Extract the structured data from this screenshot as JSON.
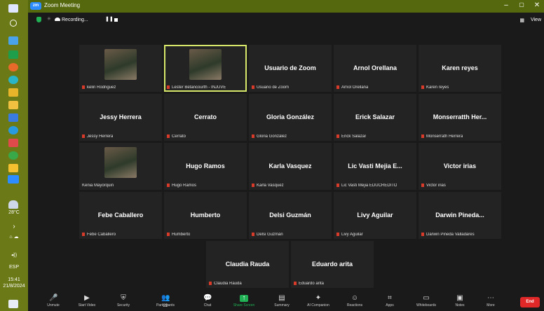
{
  "window": {
    "title": "Zoom Meeting",
    "zoom_badge": "zm"
  },
  "top": {
    "recording_label": "Recording...",
    "view_label": "View"
  },
  "participants": [
    {
      "display_name": "",
      "label": "kelin Rodriguez",
      "muted": true,
      "has_photo": true,
      "active": false
    },
    {
      "display_name": "",
      "label": "Lester Betancourth - INJUVE",
      "muted": true,
      "has_photo": true,
      "active": true
    },
    {
      "display_name": "Usuario de Zoom",
      "label": "Usuario de Zoom",
      "muted": true,
      "has_photo": false,
      "active": false
    },
    {
      "display_name": "Arnol Orellana",
      "label": "Arnol Orellana",
      "muted": true,
      "has_photo": false,
      "active": false
    },
    {
      "display_name": "Karen reyes",
      "label": "Karen reyes",
      "muted": true,
      "has_photo": false,
      "active": false
    },
    {
      "display_name": "Jessy Herrera",
      "label": "Jessy Herrera",
      "muted": true,
      "has_photo": false,
      "active": false
    },
    {
      "display_name": "Cerrato",
      "label": "Cerrato",
      "muted": true,
      "has_photo": false,
      "active": false
    },
    {
      "display_name": "Gloria González",
      "label": "Gloria González",
      "muted": true,
      "has_photo": false,
      "active": false
    },
    {
      "display_name": "Erick Salazar",
      "label": "Erick Salazar",
      "muted": true,
      "has_photo": false,
      "active": false
    },
    {
      "display_name": "Monserratth Her...",
      "label": "Monserrath Herrera",
      "muted": true,
      "has_photo": false,
      "active": false
    },
    {
      "display_name": "",
      "label": "Kenia Mayorquin",
      "muted": false,
      "has_photo": true,
      "active": false
    },
    {
      "display_name": "Hugo Ramos",
      "label": "Hugo Ramos",
      "muted": true,
      "has_photo": false,
      "active": false
    },
    {
      "display_name": "Karla Vasquez",
      "label": "Karla Vasquez",
      "muted": true,
      "has_photo": false,
      "active": false
    },
    {
      "display_name": "Lic Vasti Mejia E...",
      "label": "Lic Vasti Mejia EDUCREDITO",
      "muted": true,
      "has_photo": false,
      "active": false
    },
    {
      "display_name": "Victor irias",
      "label": "Victor irias",
      "muted": true,
      "has_photo": false,
      "active": false
    },
    {
      "display_name": "Febe Caballero",
      "label": "Febe Caballero",
      "muted": true,
      "has_photo": false,
      "active": false
    },
    {
      "display_name": "Humberto",
      "label": "Humberto",
      "muted": true,
      "has_photo": false,
      "active": false
    },
    {
      "display_name": "Delsi Guzmán",
      "label": "Delsi Guzmán",
      "muted": true,
      "has_photo": false,
      "active": false
    },
    {
      "display_name": "Livy Aguilar",
      "label": "Livy Aguilar",
      "muted": true,
      "has_photo": false,
      "active": false
    },
    {
      "display_name": "Darwin Pineda...",
      "label": "Darwin Pineda Valladares",
      "muted": true,
      "has_photo": false,
      "active": false
    },
    {
      "display_name": "Claudia Rauda",
      "label": "Claudia Rauda",
      "muted": true,
      "has_photo": false,
      "active": false
    },
    {
      "display_name": "Eduardo arita",
      "label": "Eduardo arita",
      "muted": true,
      "has_photo": false,
      "active": false
    }
  ],
  "taskbar": {
    "temperature": "28°C",
    "language": "ESP",
    "time": "15:41",
    "date": "21/8/2024"
  },
  "toolbar": {
    "unmute": "Unmute",
    "start_video": "Start Video",
    "security": "Security",
    "participants": "Participants",
    "participants_count": "22",
    "chat": "Chat",
    "share_screen": "Share Screen",
    "summary": "Summary",
    "ai_companion": "AI Companion",
    "reactions": "Reactions",
    "apps": "Apps",
    "whiteboards": "Whiteboards",
    "notes": "Notes",
    "more": "More",
    "end": "End"
  },
  "colors": {
    "taskbar": "#6b7a16",
    "active_border": "#d8e86a",
    "end": "#e02828",
    "share": "#1fb154"
  }
}
